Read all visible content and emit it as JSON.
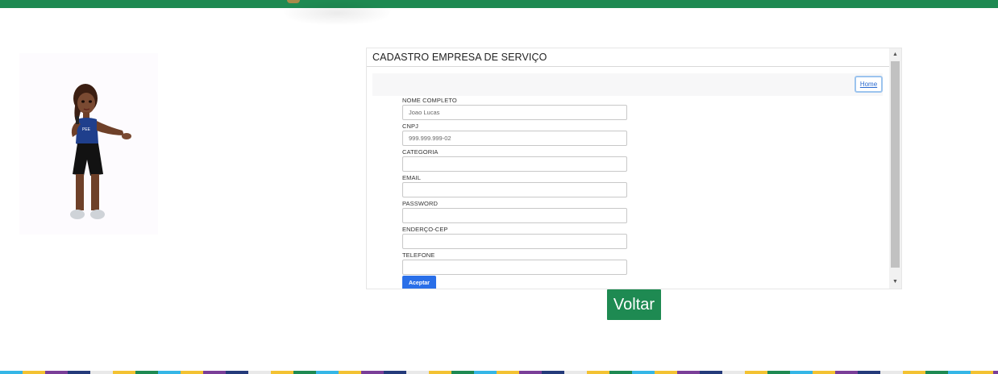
{
  "header": {
    "accent_color": "#1e8a52"
  },
  "avatar": {
    "icon": "avatar-illustration-icon"
  },
  "frame": {
    "title": "CADASTRO EMPRESA DE SERVIÇO",
    "home_label": "Home",
    "scroll_up_icon": "▲",
    "scroll_down_icon": "▼"
  },
  "form": {
    "fields": [
      {
        "label": "NOME COMPLETO",
        "value": "Joao Lucas"
      },
      {
        "label": "CNPJ",
        "value": "999.999.999-02"
      },
      {
        "label": "CATEGORIA",
        "value": ""
      },
      {
        "label": "EMAIL",
        "value": ""
      },
      {
        "label": "PASSWORD",
        "value": ""
      },
      {
        "label": "ENDERÇO-CEP",
        "value": ""
      },
      {
        "label": "TELEFONE",
        "value": ""
      }
    ],
    "submit_label": "Aceptar",
    "submit_color": "#2a6fe8"
  },
  "footer": {
    "back_label": "Voltar"
  }
}
